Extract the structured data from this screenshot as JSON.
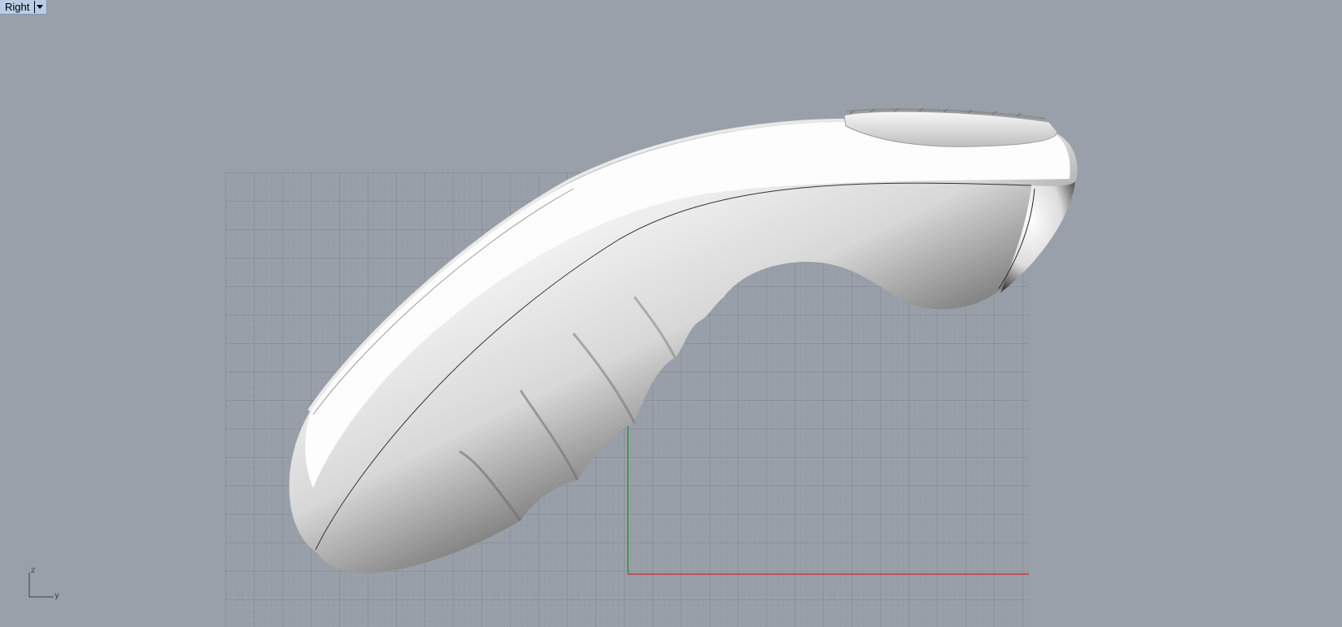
{
  "viewport": {
    "name": "Right",
    "background_color": "#9aa0a9",
    "grid_line_color": "#8a9099",
    "grid_major_color": "#7c828b",
    "x_axis_color": "#c8232c",
    "y_axis_color": "#1f8a2a",
    "dropdown_icon": "chevron-down-icon"
  },
  "axis_widget": {
    "vertical_label": "z",
    "horizontal_label": "y"
  },
  "model": {
    "color": "#ffffff",
    "description_icon": "handle-model"
  }
}
